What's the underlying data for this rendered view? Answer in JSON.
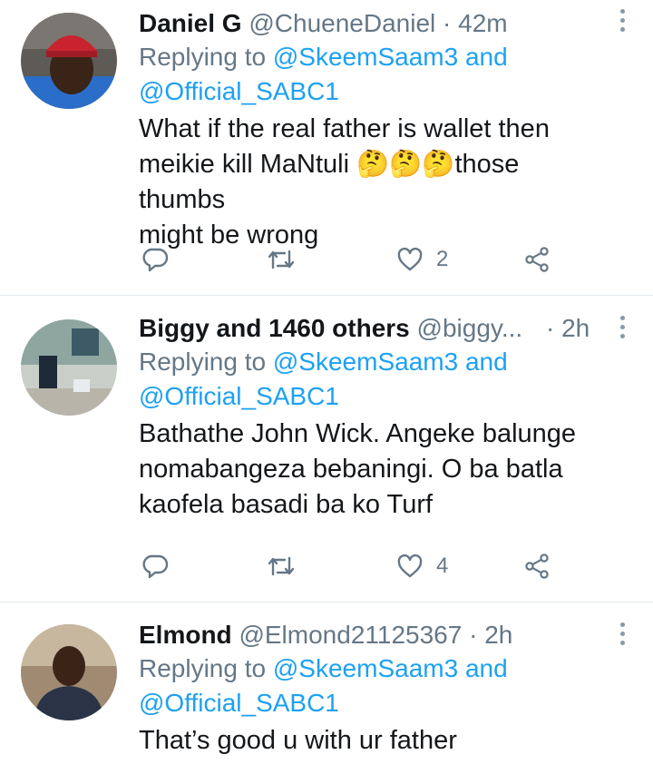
{
  "tweets": [
    {
      "name": "Daniel G",
      "handle": "@ChueneDaniel",
      "separator": "·",
      "time": "42m",
      "replying_prefix": "Replying to",
      "mention1": "@SkeemSaam3",
      "and": "and",
      "mention2": "@Official_SABC1",
      "text_line1": "What if the real father is wallet then",
      "text_line2a": "meikie kill MaNtuli ",
      "emoji": "🤔🤔🤔",
      "text_line2b": "those thumbs",
      "text_line3": "might be wrong",
      "likes": "2"
    },
    {
      "name": "Biggy and 1460 others",
      "handle": "@biggy...",
      "separator": "·",
      "time": "2h",
      "replying_prefix": "Replying to",
      "mention1": "@SkeemSaam3",
      "and": "and",
      "mention2": "@Official_SABC1",
      "text_line1": "Bathathe John Wick. Angeke balunge",
      "text_line2": "nomabangeza bebaningi. O ba batla",
      "text_line3": "kaofela basadi ba ko Turf",
      "likes": "4"
    },
    {
      "name": "Elmond",
      "handle": "@Elmond21125367",
      "separator": "·",
      "time": "2h",
      "replying_prefix": "Replying to",
      "mention1": "@SkeemSaam3",
      "and": "and",
      "mention2": "@Official_SABC1",
      "text_line1": "That’s good u with ur father"
    }
  ],
  "colors": {
    "link": "#1da1f2",
    "secondary": "#657786",
    "text": "#14171a",
    "divider": "#e1e8ed"
  },
  "icons": [
    "reply-icon",
    "retweet-icon",
    "heart-icon",
    "share-icon",
    "more-options-icon"
  ]
}
